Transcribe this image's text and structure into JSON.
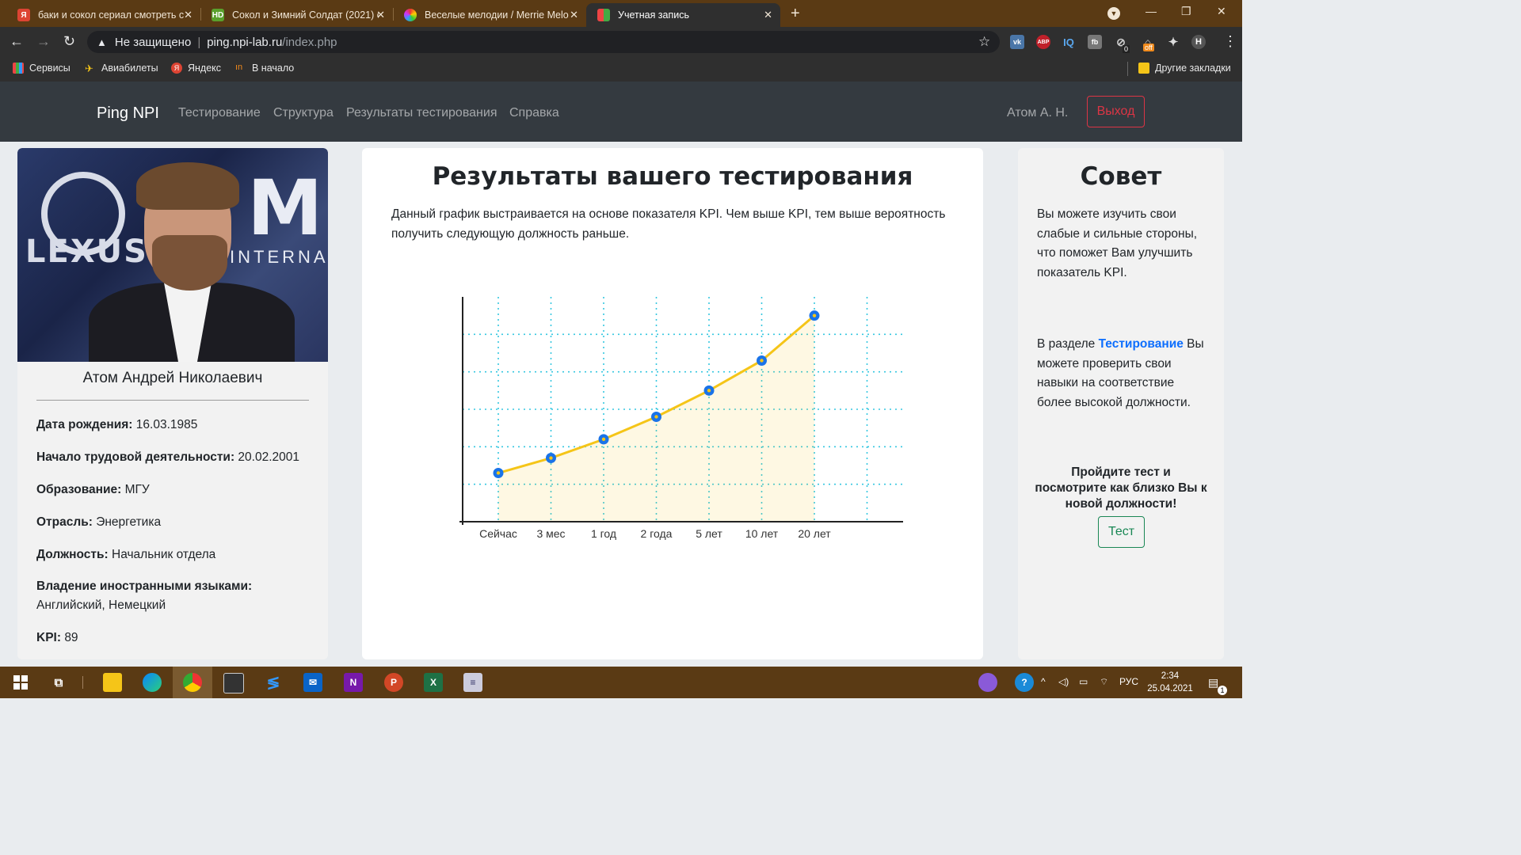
{
  "browser": {
    "tabs": [
      {
        "title": "баки и сокол сериал смотреть с",
        "icon": "yandex-icon"
      },
      {
        "title": "Сокол и Зимний Солдат (2021) с",
        "icon": "hd-icon"
      },
      {
        "title": "Веселые мелодии / Merrie Melo",
        "icon": "color-wheel-icon"
      },
      {
        "title": "Учетная запись",
        "icon": "page-icon"
      }
    ],
    "address": {
      "security": "Не защищено",
      "host": "ping.npi-lab.ru",
      "path": "/index.php"
    },
    "bookmarks": [
      "Сервисы",
      "Авиабилеты",
      "Яндекс",
      "В начало"
    ],
    "other_bookmarks": "Другие закладки",
    "profile_initial": "Н",
    "ext_badge": "0",
    "ext_off": "off",
    "ext_abp": "ABP",
    "ext_iq": "IQ"
  },
  "navbar": {
    "brand": "Ping NPI",
    "links": [
      "Тестирование",
      "Структура",
      "Результаты тестирования",
      "Справка"
    ],
    "user": "Атом А. Н.",
    "logout": "Выход"
  },
  "profile": {
    "name": "Атом Андрей Николаевич",
    "fields": [
      {
        "label": "Дата рождения:",
        "value": "16.03.1985"
      },
      {
        "label": "Начало трудовой деятельности:",
        "value": "20.02.2001"
      },
      {
        "label": "Образование:",
        "value": "МГУ"
      },
      {
        "label": "Отрасль:",
        "value": "Энергетика"
      },
      {
        "label": "Должность:",
        "value": "Начальник отдела"
      },
      {
        "label": "Владение иностранными языками:",
        "value": "Английский, Немецкий"
      },
      {
        "label": "KPI:",
        "value": "89"
      }
    ],
    "photo_text": {
      "brand": "LEXUS",
      "poster": "MI",
      "poster_sub": "INTERNA"
    }
  },
  "results": {
    "title": "Результаты вашего тестирования",
    "description": "Данный график выстраивается на основе показателя KPI. Чем выше KPI, тем выше вероятность получить следующую должность раньше."
  },
  "chart_data": {
    "type": "line",
    "title": "",
    "xlabel": "",
    "ylabel": "",
    "categories": [
      "Сейчас",
      "3 мес",
      "1 год",
      "2 года",
      "5 лет",
      "10 лет",
      "20 лет"
    ],
    "series": [
      {
        "values": [
          0.3,
          0.7,
          1.2,
          1.8,
          2.5,
          3.3,
          4.5
        ]
      }
    ],
    "ylim": [
      -1,
      5
    ],
    "grid": true,
    "line_color": "#f5c518",
    "marker_color": "#1a73e8",
    "grid_color": "#35c7e0"
  },
  "advice": {
    "title": "Совет",
    "text1": "Вы можете изучить свои слабые и сильные стороны, что поможет Вам улучшить показатель KPI.",
    "text2_prefix": "В разделе ",
    "text2_link": "Тестирование",
    "text2_suffix": " Вы можете проверить свои навыки на соответствие более высокой должности.",
    "cta": "Пройдите тест и посмотрите как близко Вы к новой должности!",
    "button": "Тест"
  },
  "taskbar": {
    "lang": "РУС",
    "time": "2:34",
    "date": "25.04.2021",
    "notifications": "1"
  },
  "colors": {
    "navbar": "#343a40",
    "danger": "#dc3545",
    "success": "#198754",
    "link": "#0d6efd"
  }
}
